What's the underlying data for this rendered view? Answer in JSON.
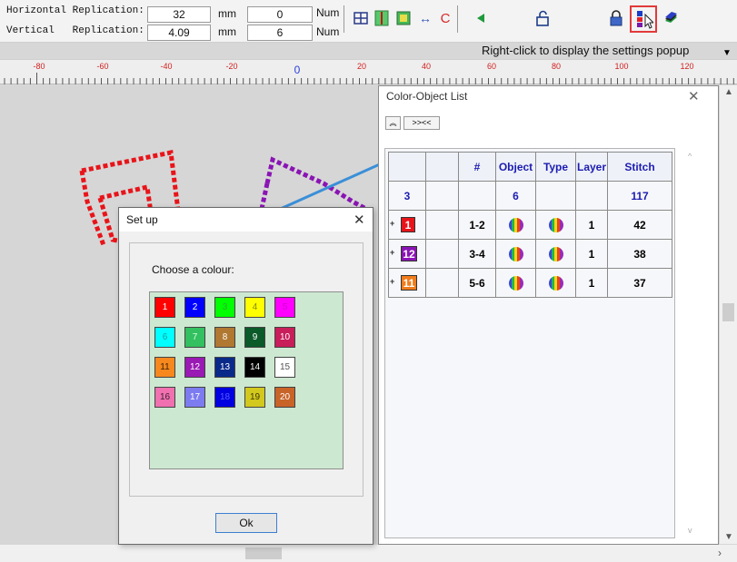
{
  "toolbar": {
    "h_label": "Horizontal Replication:",
    "v_label": "Vertical   Replication:",
    "h_value": "32",
    "h_unit": "mm",
    "h_num": "0",
    "h_num_label": "Num",
    "v_value": "4.09",
    "v_unit": "mm",
    "v_num": "6",
    "v_num_label": "Num",
    "c_label": "C"
  },
  "hint": "Right-click to display the settings popup",
  "ruler": [
    "-80",
    "-60",
    "-40",
    "-20",
    "0",
    "20",
    "40",
    "60",
    "80",
    "100",
    "120"
  ],
  "color_list": {
    "title": "Color-Object List",
    "expand_label": ">><<",
    "headers": [
      "",
      "",
      "#",
      "Object",
      "Type",
      "Layer",
      "Stitch"
    ],
    "summary": {
      "colors": "3",
      "objects": "6",
      "stitch": "117"
    },
    "rows": [
      {
        "color": "1",
        "color_hex": "#e8141a",
        "range": "1-2",
        "layer": "1",
        "stitch": "42"
      },
      {
        "color": "12",
        "color_hex": "#8a14b4",
        "range": "3-4",
        "layer": "1",
        "stitch": "38"
      },
      {
        "color": "11",
        "color_hex": "#f07c1c",
        "range": "5-6",
        "layer": "1",
        "stitch": "37"
      }
    ]
  },
  "setup": {
    "title": "Set up",
    "prompt": "Choose a colour:",
    "ok": "Ok",
    "colours": [
      {
        "n": "1",
        "hex": "#ff0000",
        "text": "#ffffff"
      },
      {
        "n": "2",
        "hex": "#0000ff",
        "text": "#ffffff"
      },
      {
        "n": "3",
        "hex": "#00ff00",
        "text": "#33aa33"
      },
      {
        "n": "4",
        "hex": "#ffff00",
        "text": "#888800"
      },
      {
        "n": "5",
        "hex": "#ff00ff",
        "text": "#cc00cc"
      },
      {
        "n": "6",
        "hex": "#00ffff",
        "text": "#1b9f9f"
      },
      {
        "n": "7",
        "hex": "#33c060",
        "text": "#d4ffe0"
      },
      {
        "n": "8",
        "hex": "#b07830",
        "text": "#ffffff"
      },
      {
        "n": "9",
        "hex": "#0a5a2a",
        "text": "#ffffff"
      },
      {
        "n": "10",
        "hex": "#c81e5a",
        "text": "#ffffff"
      },
      {
        "n": "11",
        "hex": "#f6881e",
        "text": "#402000"
      },
      {
        "n": "12",
        "hex": "#9a1ab4",
        "text": "#ffffff"
      },
      {
        "n": "13",
        "hex": "#0a2a8a",
        "text": "#ffffff"
      },
      {
        "n": "14",
        "hex": "#000000",
        "text": "#ffffff"
      },
      {
        "n": "15",
        "hex": "#ffffff",
        "text": "#555555"
      },
      {
        "n": "16",
        "hex": "#f070b0",
        "text": "#402030"
      },
      {
        "n": "17",
        "hex": "#7c7cf0",
        "text": "#ffffff"
      },
      {
        "n": "18",
        "hex": "#0000e0",
        "text": "#5a5aff"
      },
      {
        "n": "19",
        "hex": "#d2c81e",
        "text": "#403a00"
      },
      {
        "n": "20",
        "hex": "#c86428",
        "text": "#ffffff"
      }
    ]
  }
}
